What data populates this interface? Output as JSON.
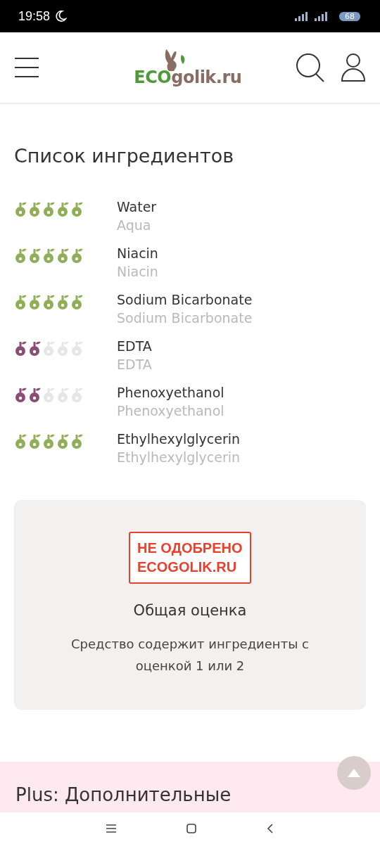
{
  "status_bar": {
    "time": "19:58",
    "battery": "68"
  },
  "header": {
    "logo": {
      "eco": "ECO",
      "rest": "golik.ru"
    }
  },
  "ingredients": {
    "title": "Список ингредиентов",
    "items": [
      {
        "name": "Water",
        "inci": "Aqua",
        "stars": 5,
        "color": "#8fae57"
      },
      {
        "name": "Niacin",
        "inci": "Niacin",
        "stars": 5,
        "color": "#8fae57"
      },
      {
        "name": "Sodium Bicarbonate",
        "inci": "Sodium Bicarbonate",
        "stars": 5,
        "color": "#8fae57"
      },
      {
        "name": "EDTA",
        "inci": "EDTA",
        "stars": 2,
        "color": "#8a4c72"
      },
      {
        "name": "Phenoxyethanol",
        "inci": "Phenoxyethanol",
        "stars": 2,
        "color": "#8a4c72"
      },
      {
        "name": "Ethylhexylglycerin",
        "inci": "Ethylhexylglycerin",
        "stars": 5,
        "color": "#8fae57"
      }
    ]
  },
  "verdict": {
    "stamp": [
      "НЕ ОДОБРЕНО",
      "ECOGOLIK.RU"
    ],
    "title": "Общая оценка",
    "text": "Средство содержит ингредиенты с оценкой 1 или 2"
  },
  "next_section": {
    "title": "Plus: Дополнительные"
  }
}
